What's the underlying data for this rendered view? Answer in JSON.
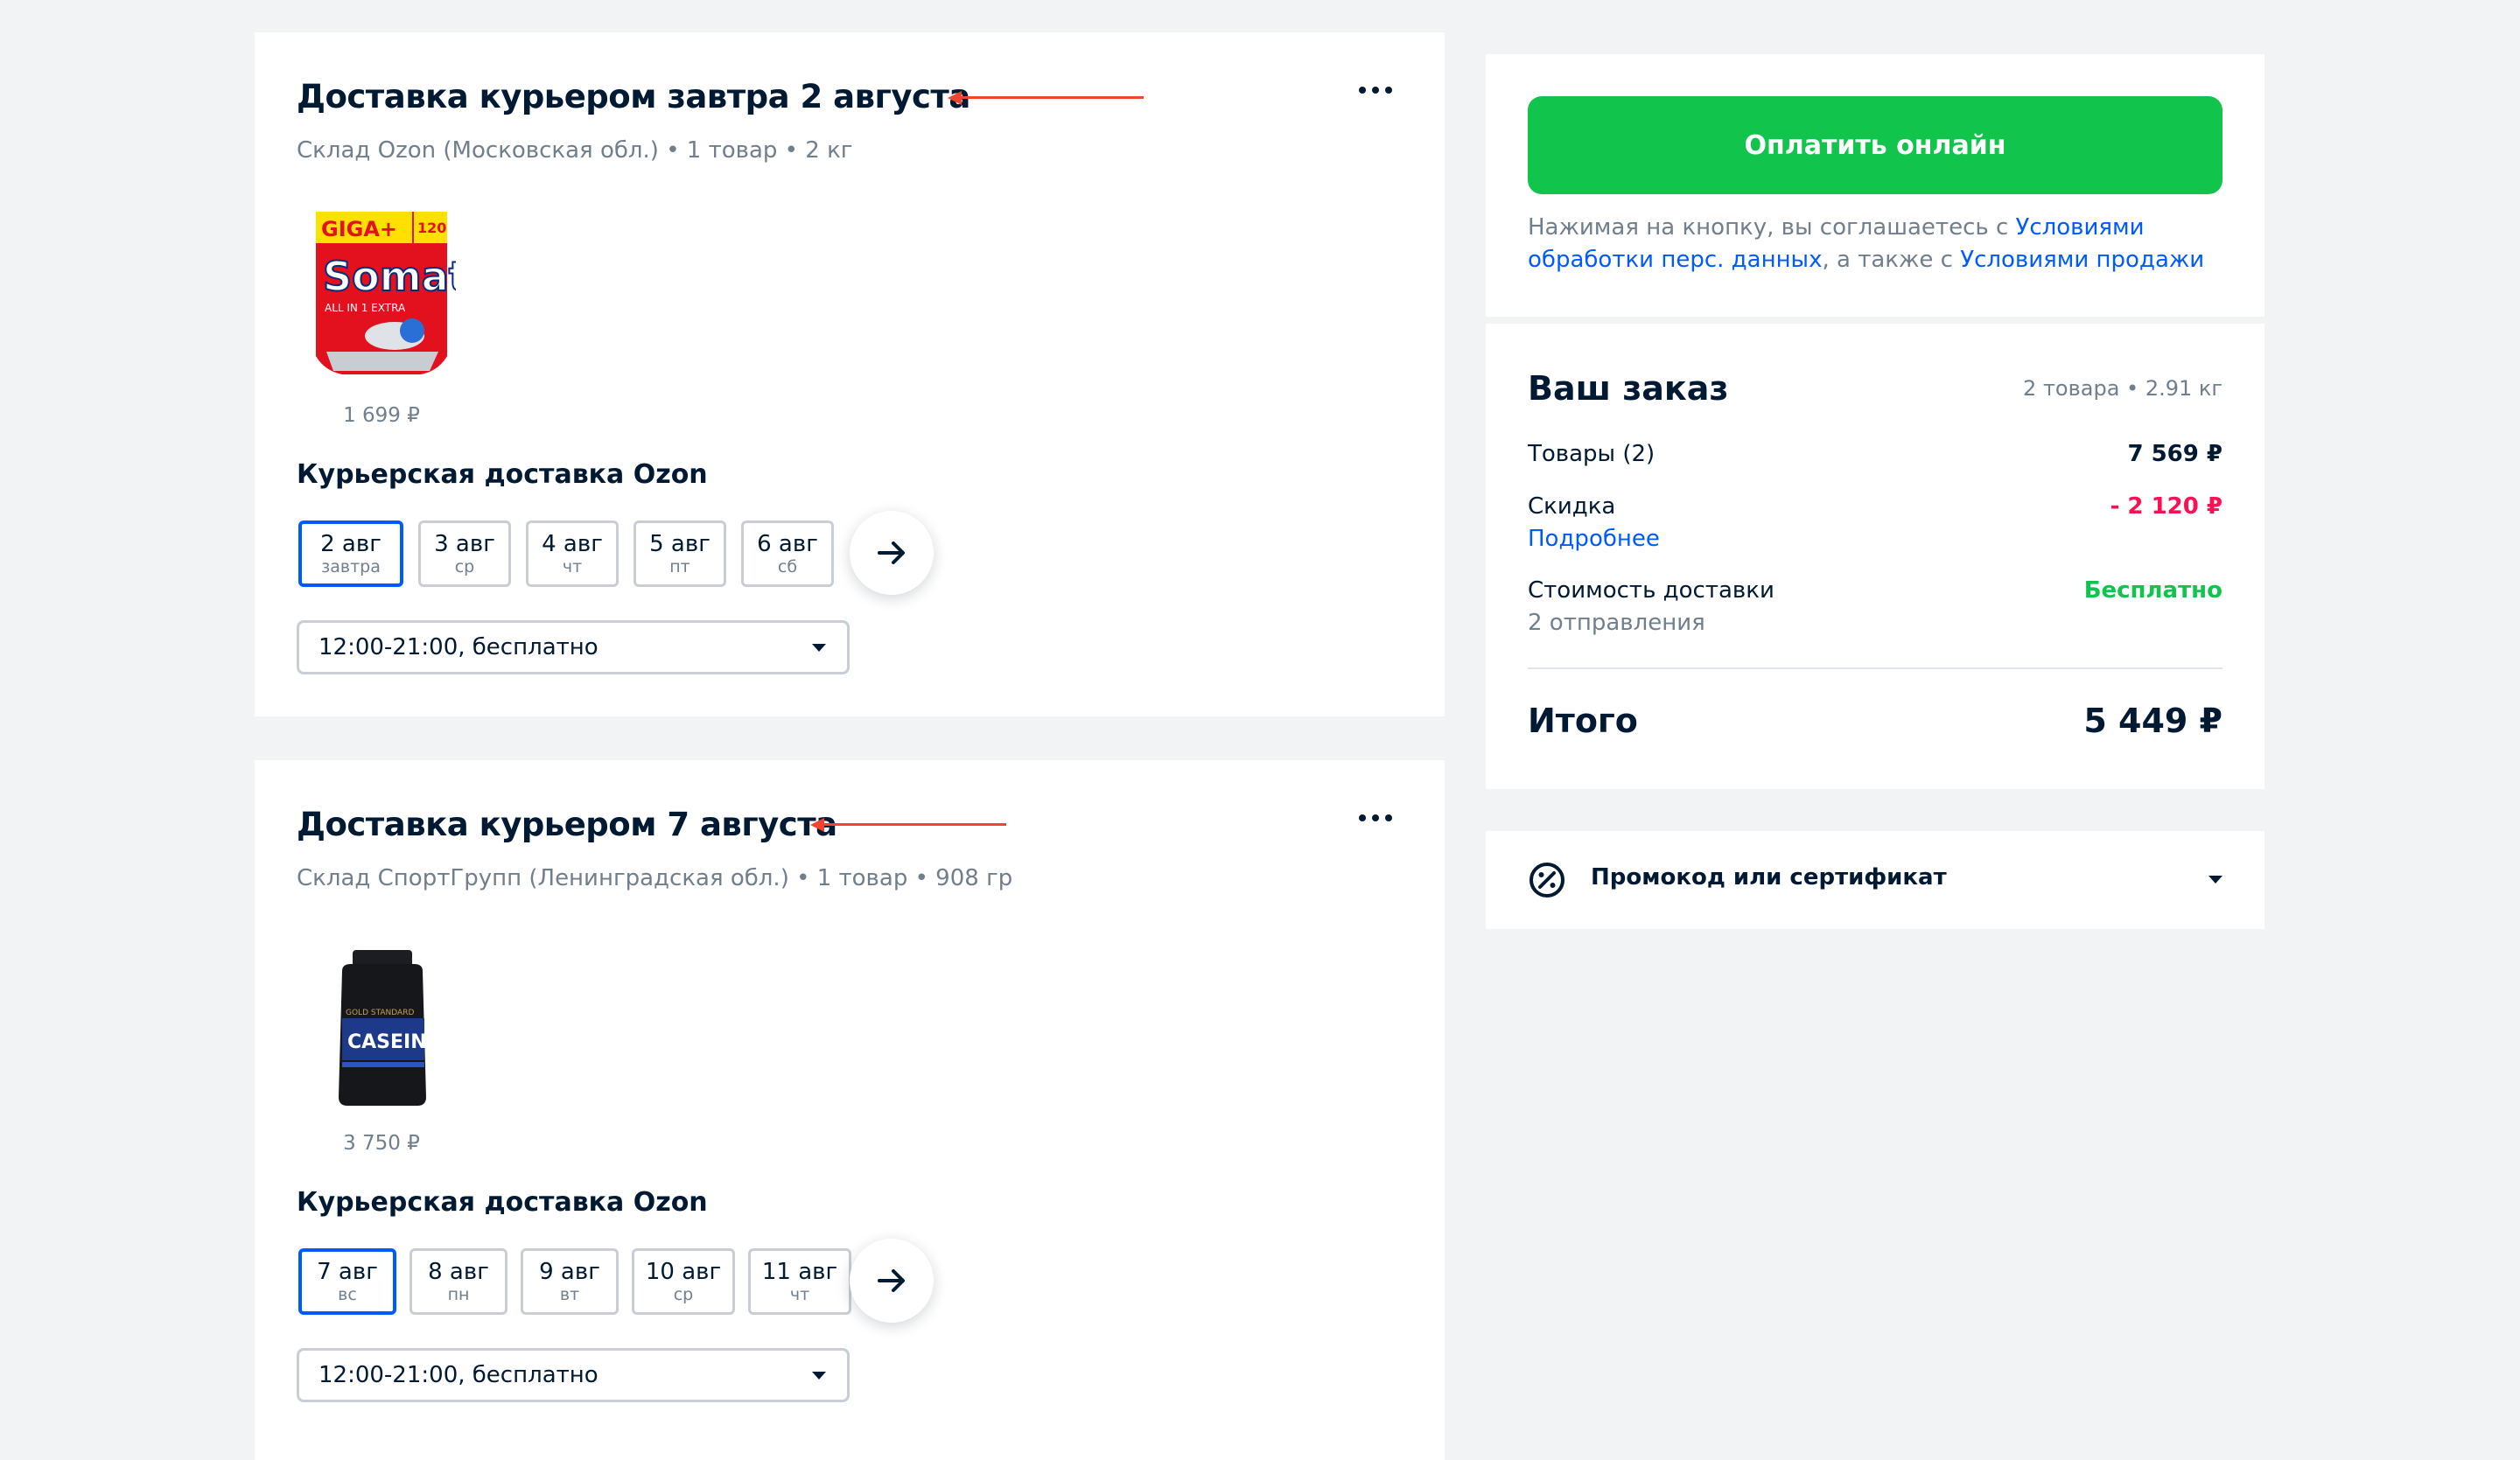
{
  "colors": {
    "accent": "#005bff",
    "pay_button": "#10c44c",
    "discount": "#f91155",
    "free": "#10c44c",
    "annotation_arrow": "#f1452e",
    "background": "#f2f3f5"
  },
  "shipments": [
    {
      "title": "Доставка курьером завтра 2 августа",
      "subtitle": "Склад Ozon (Московская обл.) • 1 товар • 2 кг",
      "product": {
        "image": "somat-giga-plus-dishwasher-tablets",
        "image_texts": [
          "GIGA+",
          "120",
          "Somat",
          "ALL IN 1 EXTRA"
        ],
        "price": "1 699 ₽"
      },
      "method": "Курьерская доставка Ozon",
      "dates": [
        {
          "date": "2 авг",
          "weekday": "завтра",
          "selected": true
        },
        {
          "date": "3 авг",
          "weekday": "ср",
          "selected": false
        },
        {
          "date": "4 авг",
          "weekday": "чт",
          "selected": false
        },
        {
          "date": "5 авг",
          "weekday": "пт",
          "selected": false
        },
        {
          "date": "6 авг",
          "weekday": "сб",
          "selected": false
        }
      ],
      "time_slot": "12:00-21:00, бесплатно"
    },
    {
      "title": "Доставка курьером 7 августа",
      "subtitle": "Склад СпортГрупп (Ленинградская обл.) • 1 товар • 908 гр",
      "product": {
        "image": "casein-protein-jar",
        "image_texts": [
          "GOLD STANDARD",
          "CASEIN"
        ],
        "price": "3 750 ₽"
      },
      "method": "Курьерская доставка Ozon",
      "dates": [
        {
          "date": "7 авг",
          "weekday": "вс",
          "selected": true
        },
        {
          "date": "8 авг",
          "weekday": "пн",
          "selected": false
        },
        {
          "date": "9 авг",
          "weekday": "вт",
          "selected": false
        },
        {
          "date": "10 авг",
          "weekday": "ср",
          "selected": false
        },
        {
          "date": "11 авг",
          "weekday": "чт",
          "selected": false
        }
      ],
      "time_slot": "12:00-21:00, бесплатно"
    }
  ],
  "payment": {
    "button_label": "Оплатить онлайн",
    "terms_prefix": "Нажимая на кнопку, вы соглашаетесь с ",
    "terms_link1": "Условиями обработки перс. данных",
    "terms_middle": ", а также с ",
    "terms_link2": "Условиями продажи"
  },
  "order": {
    "title": "Ваш заказ",
    "meta": "2 товара • 2.91 кг",
    "goods_label": "Товары (2)",
    "goods_value": "7 569 ₽",
    "discount_label": "Скидка",
    "discount_link": "Подробнее",
    "discount_value": "- 2 120 ₽",
    "delivery_label": "Стоимость доставки",
    "delivery_sub": "2  отправления",
    "delivery_value": "Бесплатно",
    "total_label": "Итого",
    "total_value": "5 449 ₽"
  },
  "promo": {
    "label": "Промокод или сертификат",
    "icon": "discount-percent-icon"
  }
}
